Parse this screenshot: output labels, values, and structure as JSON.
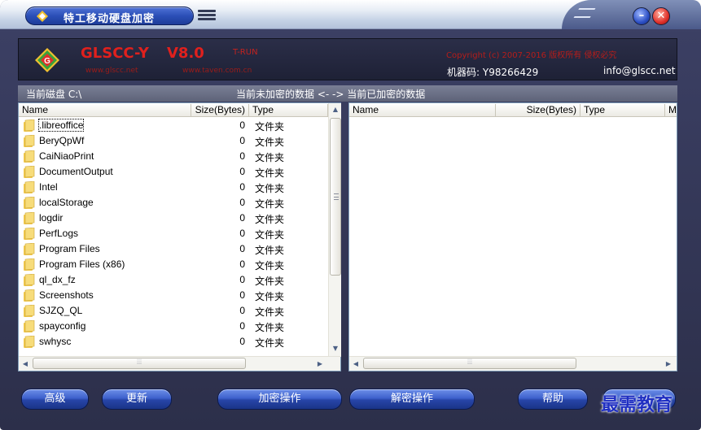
{
  "window": {
    "title": "特工移动硬盘加密"
  },
  "header": {
    "app_name": "GLSCC-Y",
    "version": "V8.0",
    "edition": "T-RUN",
    "website1": "www.glscc.net",
    "website2": "www.taven.com.cn",
    "copyright": "Copyright (c) 2007-2016 版权所有 侵权必究",
    "machine_code": "机器码: Y98266429",
    "email": "info@glscc.net"
  },
  "status": {
    "current_disk": "当前磁盘 C:\\",
    "panel_hint": "当前未加密的数据 <- -> 当前已加密的数据"
  },
  "left_list": {
    "columns": [
      "Name",
      "Size(Bytes)",
      "Type"
    ],
    "rows": [
      {
        "name": ".libreoffice",
        "size": "0",
        "type": "文件夹"
      },
      {
        "name": "BeryQpWf",
        "size": "0",
        "type": "文件夹"
      },
      {
        "name": "CaiNiaoPrint",
        "size": "0",
        "type": "文件夹"
      },
      {
        "name": "DocumentOutput",
        "size": "0",
        "type": "文件夹"
      },
      {
        "name": "Intel",
        "size": "0",
        "type": "文件夹"
      },
      {
        "name": "localStorage",
        "size": "0",
        "type": "文件夹"
      },
      {
        "name": "logdir",
        "size": "0",
        "type": "文件夹"
      },
      {
        "name": "PerfLogs",
        "size": "0",
        "type": "文件夹"
      },
      {
        "name": "Program Files",
        "size": "0",
        "type": "文件夹"
      },
      {
        "name": "Program Files (x86)",
        "size": "0",
        "type": "文件夹"
      },
      {
        "name": "ql_dx_fz",
        "size": "0",
        "type": "文件夹"
      },
      {
        "name": "Screenshots",
        "size": "0",
        "type": "文件夹"
      },
      {
        "name": "SJZQ_QL",
        "size": "0",
        "type": "文件夹"
      },
      {
        "name": "spayconfig",
        "size": "0",
        "type": "文件夹"
      },
      {
        "name": "swhysc",
        "size": "0",
        "type": "文件夹"
      }
    ]
  },
  "right_list": {
    "columns": [
      "Name",
      "Size(Bytes)",
      "Type",
      "M"
    ]
  },
  "buttons": {
    "advanced": "高级",
    "update": "更新",
    "encrypt": "加密操作",
    "decrypt": "解密操作",
    "help": "帮助"
  },
  "watermark": "最需教育",
  "icons": {
    "folder": "folder-icon",
    "menu": "menu-icon",
    "minimize": "minimize-icon",
    "close": "close-icon"
  },
  "colors": {
    "accent": "#2b4fb7",
    "brand_red": "#e0201d",
    "folder": "#f2c94c"
  }
}
